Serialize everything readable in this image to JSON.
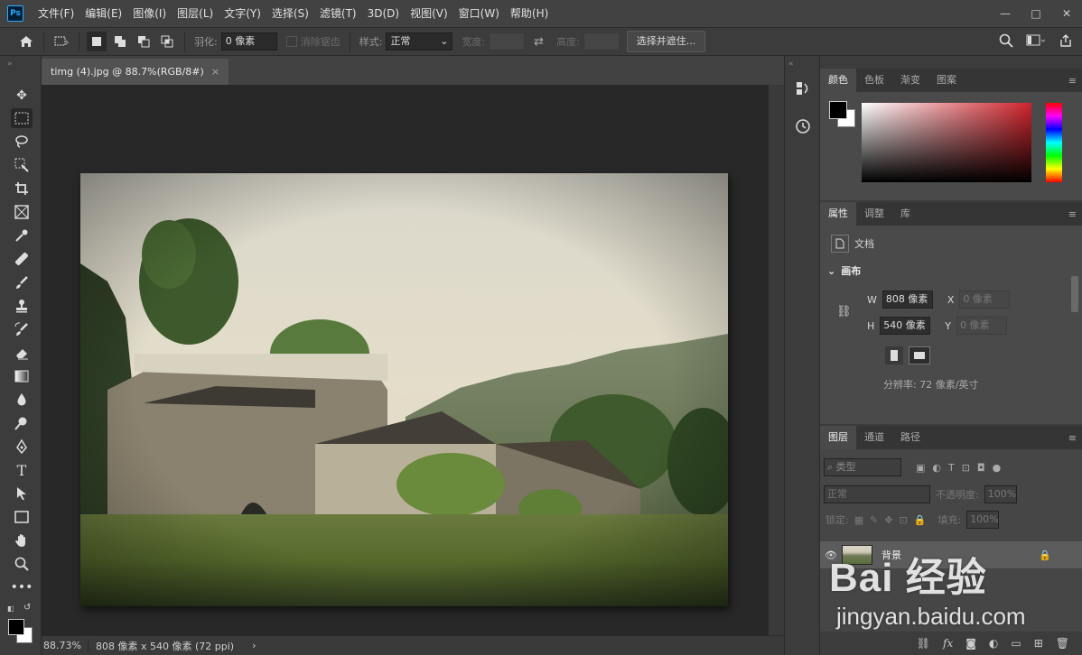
{
  "menubar": {
    "logo": "Ps",
    "items": [
      "文件(F)",
      "编辑(E)",
      "图像(I)",
      "图层(L)",
      "文字(Y)",
      "选择(S)",
      "滤镜(T)",
      "3D(D)",
      "视图(V)",
      "窗口(W)",
      "帮助(H)"
    ],
    "window_controls": [
      "—",
      "□",
      "✕"
    ]
  },
  "options": {
    "feather_label": "羽化:",
    "feather_value": "0 像素",
    "antialias_label": "消除锯齿",
    "style_label": "样式:",
    "style_value": "正常",
    "width_label": "宽度:",
    "height_label": "高度:",
    "select_mask_button": "选择并遮住..."
  },
  "document": {
    "tab_title": "timg (4).jpg @ 88.7%(RGB/8#)",
    "tab_close": "×"
  },
  "status": {
    "zoom": "88.73%",
    "info": "808 像素 x 540 像素 (72 ppi)",
    "arrow": "›"
  },
  "color_panel": {
    "tabs": [
      "颜色",
      "色板",
      "渐变",
      "图案"
    ],
    "accent_fg": "#000000",
    "accent_bg": "#ffffff"
  },
  "properties_panel": {
    "tabs": [
      "属性",
      "调整",
      "库"
    ],
    "doc_label": "文档",
    "section": "画布",
    "w_label": "W",
    "w_value": "808 像素",
    "h_label": "H",
    "h_value": "540 像素",
    "x_label": "X",
    "x_placeholder": "0 像素",
    "y_label": "Y",
    "y_placeholder": "0 像素",
    "resolution": "分辨率: 72 像素/英寸"
  },
  "layers_panel": {
    "tabs": [
      "图层",
      "通道",
      "路径"
    ],
    "kind_placeholder": "类型",
    "blend_mode": "正常",
    "opacity_label": "不透明度:",
    "opacity_value": "100%",
    "lock_label": "锁定:",
    "fill_label": "填充:",
    "fill_value": "100%",
    "layer_name": "背景"
  },
  "watermark": {
    "brand": "Bai 经验",
    "url": "jingyan.baidu.com"
  }
}
